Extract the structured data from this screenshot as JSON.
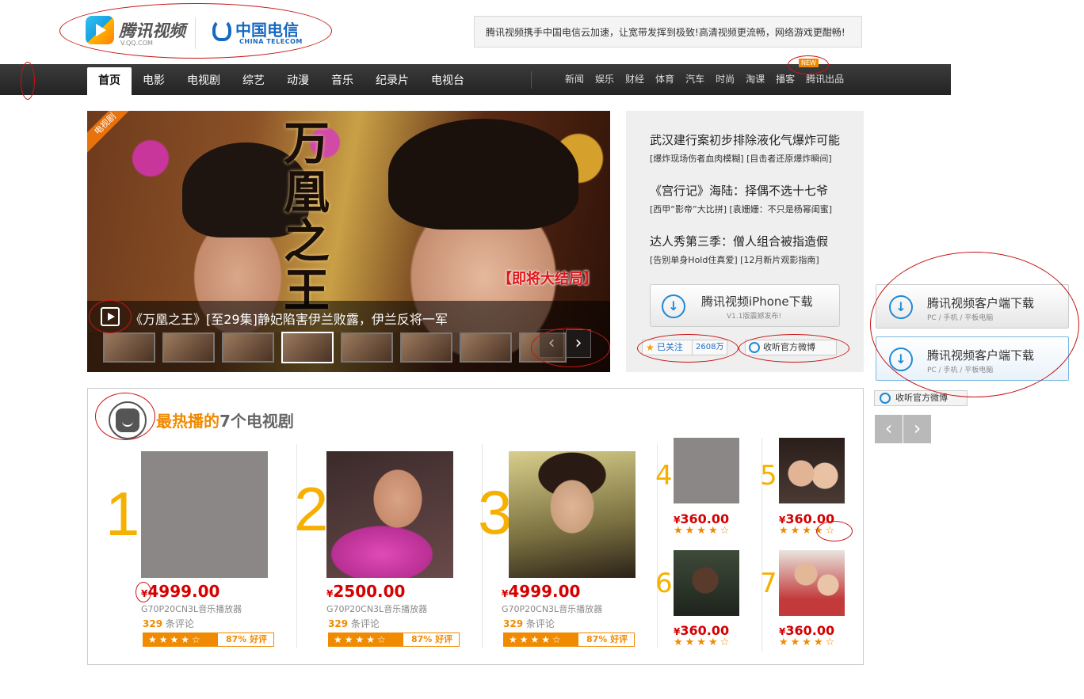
{
  "header": {
    "qq_logo_text": "腾讯视频",
    "qq_logo_sub": "V.QQ.COM",
    "telecom_cn": "中国电信",
    "telecom_en": "CHINA TELECOM",
    "notice": "腾讯视频携手中国电信云加速，让宽带发挥到极致!高清视频更流畅，网络游戏更酣畅!"
  },
  "nav": {
    "main": [
      "首页",
      "电影",
      "电视剧",
      "综艺",
      "动漫",
      "音乐",
      "纪录片",
      "电视台"
    ],
    "active_index": 0,
    "sub": [
      "新闻",
      "娱乐",
      "财经",
      "体育",
      "汽车",
      "时尚",
      "淘课",
      "播客",
      "腾讯出品"
    ],
    "new_badge": "NEW"
  },
  "banner": {
    "tag": "电视剧",
    "title_art": "万凰之王",
    "finale": "【即将大结局】",
    "caption": "《万凰之王》[至29集]静妃陷害伊兰败露，伊兰反将一军",
    "thumb_count": 8,
    "active_thumb": 3,
    "prev_arrow": "‹",
    "next_arrow": "›"
  },
  "news": [
    {
      "head": "武汉建行案初步排除液化气爆炸可能",
      "sub": "[爆炸现场伤者血肉模糊] [目击者还原爆炸瞬间]"
    },
    {
      "head": "《宫行记》海陆：择偶不选十七爷",
      "sub": "[西甲“影帝”大比拼] [袁姗姗：不只是杨幂闺蜜]"
    },
    {
      "head": "达人秀第三季：僧人组合被指造假",
      "sub": "[告别单身Hold住真爱] [12月新片观影指南]"
    }
  ],
  "download": {
    "title": "腾讯视频iPhone下载",
    "sub": "V1.1版震撼发布!"
  },
  "follow": {
    "label": "已关注",
    "count": "2608万"
  },
  "weibo": {
    "label": "收听官方微博"
  },
  "side": {
    "buttons": [
      {
        "title": "腾讯视频客户端下载",
        "sub": "PC / 手机 / 平板电脑"
      },
      {
        "title": "腾讯视频客户端下载",
        "sub": "PC / 手机 / 平板电脑"
      }
    ],
    "weibo": "收听官方微博",
    "prev": "‹",
    "next": "›"
  },
  "hot": {
    "title_hi": "最热播的",
    "title_rest": "7个电视剧",
    "big": [
      {
        "rank": "1",
        "currency": "¥",
        "price": "4999.00",
        "desc": "G70P20CN3L音乐播放器",
        "comments": "329",
        "comments_label": "条评论",
        "stars": "★★★★☆",
        "good": "87%",
        "good_label": "好评"
      },
      {
        "rank": "2",
        "currency": "¥",
        "price": "2500.00",
        "desc": "G70P20CN3L音乐播放器",
        "comments": "329",
        "comments_label": "条评论",
        "stars": "★★★★☆",
        "good": "87%",
        "good_label": "好评"
      },
      {
        "rank": "3",
        "currency": "¥",
        "price": "4999.00",
        "desc": "G70P20CN3L音乐播放器",
        "comments": "329",
        "comments_label": "条评论",
        "stars": "★★★★☆",
        "good": "87%",
        "good_label": "好评"
      }
    ],
    "small": [
      {
        "rank": "4",
        "currency": "¥",
        "price": "360.00",
        "stars": "★★★★☆"
      },
      {
        "rank": "5",
        "currency": "¥",
        "price": "360.00",
        "stars": "★★★★☆"
      },
      {
        "rank": "6",
        "currency": "¥",
        "price": "360.00",
        "stars": "★★★★☆"
      },
      {
        "rank": "7",
        "currency": "¥",
        "price": "360.00",
        "stars": "★★★★☆"
      }
    ]
  },
  "colors": {
    "accent": "#f08a00",
    "price": "#d60000",
    "nav_bg": "#2e2e2e",
    "annotation": "#c81414"
  }
}
